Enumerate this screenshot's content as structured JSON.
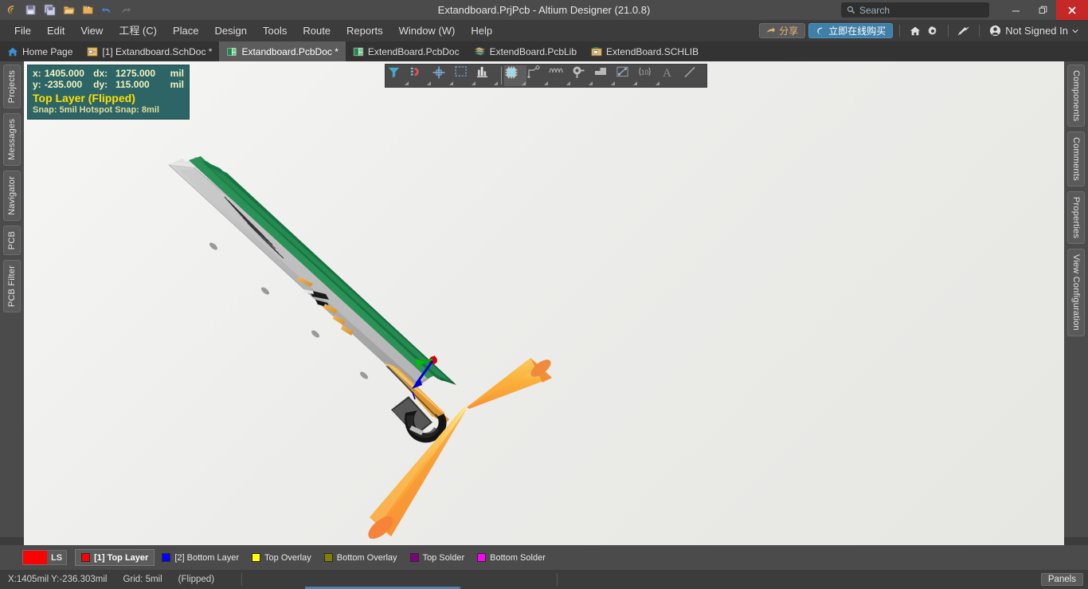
{
  "window": {
    "title": "Extandboard.PrjPcb - Altium Designer (21.0.8)",
    "minimize_label": "–",
    "restore_label": "❐",
    "close_label": "✕"
  },
  "quick_access": [
    {
      "name": "altium-logo-icon",
      "glyph": "༺"
    },
    {
      "name": "save-icon",
      "glyph": "💾"
    },
    {
      "name": "save-all-icon",
      "glyph": "💾"
    },
    {
      "name": "open-icon",
      "glyph": "📂"
    },
    {
      "name": "open-project-icon",
      "glyph": "📁"
    },
    {
      "name": "undo-icon",
      "glyph": "↶"
    },
    {
      "name": "redo-icon",
      "glyph": "↷"
    }
  ],
  "search": {
    "placeholder": "Search",
    "value": "",
    "icon": "search-icon"
  },
  "menu": {
    "items": [
      {
        "label": "File",
        "key": "F"
      },
      {
        "label": "Edit",
        "key": "E"
      },
      {
        "label": "View",
        "key": "V"
      },
      {
        "label": "工程 (C)",
        "key": "C"
      },
      {
        "label": "Place",
        "key": "P"
      },
      {
        "label": "Design",
        "key": "D"
      },
      {
        "label": "Tools",
        "key": "T"
      },
      {
        "label": "Route",
        "key": "u"
      },
      {
        "label": "Reports",
        "key": "R"
      },
      {
        "label": "Window (W)",
        "key": "W"
      },
      {
        "label": "Help",
        "key": "H"
      }
    ],
    "share_label": "分享",
    "buy_label": "立即在线购买",
    "signin_label": "Not Signed In",
    "home_icon": "home-icon",
    "settings_icon": "gear-icon",
    "extensions_icon": "extensions-icon",
    "account_icon": "account-icon",
    "dropdown_icon": "chevron-down-icon"
  },
  "document_tabs": [
    {
      "label": "Home Page",
      "icon": "home-icon",
      "active": false
    },
    {
      "label": "[1] Extandboard.SchDoc *",
      "icon": "schdoc-icon",
      "active": false
    },
    {
      "label": "Extandboard.PcbDoc *",
      "icon": "pcbdoc-icon",
      "active": true
    },
    {
      "label": "ExtendBoard.PcbDoc",
      "icon": "pcbdoc-icon",
      "active": false
    },
    {
      "label": "ExtendBoard.PcbLib",
      "icon": "pcblib-icon",
      "active": false
    },
    {
      "label": "ExtendBoard.SCHLIB",
      "icon": "schlib-icon",
      "active": false
    }
  ],
  "left_rail": [
    {
      "label": "Projects"
    },
    {
      "label": "Messages"
    },
    {
      "label": "Navigator"
    },
    {
      "label": "PCB"
    },
    {
      "label": "PCB Filter"
    }
  ],
  "right_rail": [
    {
      "label": "Components"
    },
    {
      "label": "Comments"
    },
    {
      "label": "Properties"
    },
    {
      "label": "View Configuration"
    }
  ],
  "hud": {
    "x_key": "x:",
    "x_value": "1405.000",
    "dx_key": "dx:",
    "dx_value": "1275.000",
    "dx_unit": "mil",
    "y_key": "y:",
    "y_value": "-235.000",
    "dy_key": "dy:",
    "dy_value": "115.000",
    "dy_unit": "mil",
    "layer": "Top Layer (Flipped)",
    "snap": "Snap: 5mil Hotspot Snap: 8mil"
  },
  "float_toolbar": [
    {
      "name": "filter-icon",
      "corner": true
    },
    {
      "name": "magnet-snap-icon",
      "corner": true
    },
    {
      "name": "crosshair-placement-icon",
      "corner": true
    },
    {
      "name": "selection-rectangle-icon",
      "corner": true
    },
    {
      "name": "layer-stack-icon",
      "corner": true
    },
    {
      "separator": true
    },
    {
      "name": "place-component-icon",
      "corner": true,
      "active": true
    },
    {
      "name": "route-trace-icon",
      "corner": true
    },
    {
      "name": "place-polygon-icon",
      "corner": true
    },
    {
      "name": "place-via-icon",
      "corner": true
    },
    {
      "name": "place-fill-icon",
      "corner": true
    },
    {
      "name": "place-dimension-icon",
      "corner": true
    },
    {
      "name": "place-coordinate-icon",
      "corner": true
    },
    {
      "name": "place-string-icon",
      "corner": false
    },
    {
      "name": "place-line-icon",
      "corner": false
    }
  ],
  "layer_bar": {
    "ls_label": "LS",
    "ls_color": "#ff0000",
    "layers": [
      {
        "label": "[1] Top Layer",
        "color": "#ff0000",
        "active": true
      },
      {
        "label": "[2] Bottom Layer",
        "color": "#0000ff",
        "active": false
      },
      {
        "label": "Top Overlay",
        "color": "#ffff00",
        "active": false
      },
      {
        "label": "Bottom Overlay",
        "color": "#808000",
        "active": false
      },
      {
        "label": "Top Solder",
        "color": "#800080",
        "active": false
      },
      {
        "label": "Bottom Solder",
        "color": "#ff00ff",
        "active": false
      }
    ]
  },
  "status_bar": {
    "coords": "X:1405mil Y:-236.303mil",
    "grid": "Grid: 5mil",
    "flipped": "(Flipped)",
    "panels_label": "Panels"
  },
  "viewport": {
    "view_mode": "3D PCB board view",
    "background_top": "#f6f6f4",
    "background_bottom": "#e6e6e2",
    "board_substrate_color": "#1e7a46",
    "heatsink_color": "#b9b9b9",
    "connector_color": "#e8a33d",
    "cone_color": "#f7941e",
    "axis_x_color": "#d40000",
    "axis_y_color": "#00c000",
    "axis_z_color": "#0000d4"
  }
}
